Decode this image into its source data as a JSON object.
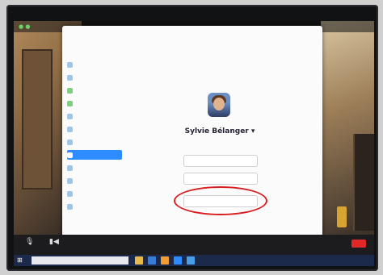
{
  "zoom": {
    "recording_label": "",
    "participant_name": "",
    "end_label": ""
  },
  "settings": {
    "window_title": "",
    "nav_items": [
      {
        "label": "",
        "icon": "gear-icon"
      },
      {
        "label": "",
        "icon": "video-icon"
      },
      {
        "label": "",
        "icon": "headphones-icon"
      },
      {
        "label": "",
        "icon": "share-screen-icon"
      },
      {
        "label": "",
        "icon": "chat-icon"
      },
      {
        "label": "",
        "icon": "background-icon"
      },
      {
        "label": "",
        "icon": "recording-icon"
      },
      {
        "label": "",
        "icon": "profile-icon",
        "active": true
      },
      {
        "label": "",
        "icon": "statistics-icon"
      },
      {
        "label": "",
        "icon": "shortcuts-icon"
      },
      {
        "label": "",
        "icon": "accessibility-icon"
      },
      {
        "label": "",
        "icon": "more-icon"
      }
    ],
    "profile": {
      "name": "Sylvie Bélanger",
      "subtext": "",
      "buttons": [
        "",
        "",
        ""
      ]
    }
  },
  "taskbar": {
    "search_placeholder": "",
    "time": "",
    "date": ""
  },
  "colors": {
    "accent": "#2d8cff",
    "highlight_circle": "#d92020",
    "end_button": "#e02828",
    "taskbar": "#1b2a4a"
  }
}
